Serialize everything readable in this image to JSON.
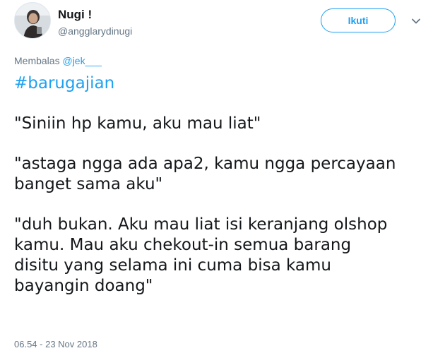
{
  "user": {
    "display_name": "Nugi !",
    "username": "@angglarydinugi"
  },
  "follow_button": {
    "label": "Ikuti"
  },
  "reply": {
    "prefix": "Membalas",
    "mention": "@jek___"
  },
  "tweet": {
    "hashtag": "#barugajian",
    "lines": [
      "\"Siniin hp kamu, aku mau liat\"",
      "\"astaga ngga ada apa2, kamu ngga percayaan",
      "banget sama aku\"",
      "\"duh bukan. Aku mau liat isi keranjang olshop",
      "kamu. Mau aku chekout-in semua barang",
      "disitu yang selama ini cuma bisa kamu",
      "bayangin doang\""
    ]
  },
  "timestamp": "06.54 - 23 Nov 2018",
  "icons": {
    "avatar": "user-avatar",
    "caret": "chevron-down-icon"
  },
  "colors": {
    "accent": "#1da1f2",
    "secondary_text": "#657786",
    "primary_text": "#14171a"
  }
}
